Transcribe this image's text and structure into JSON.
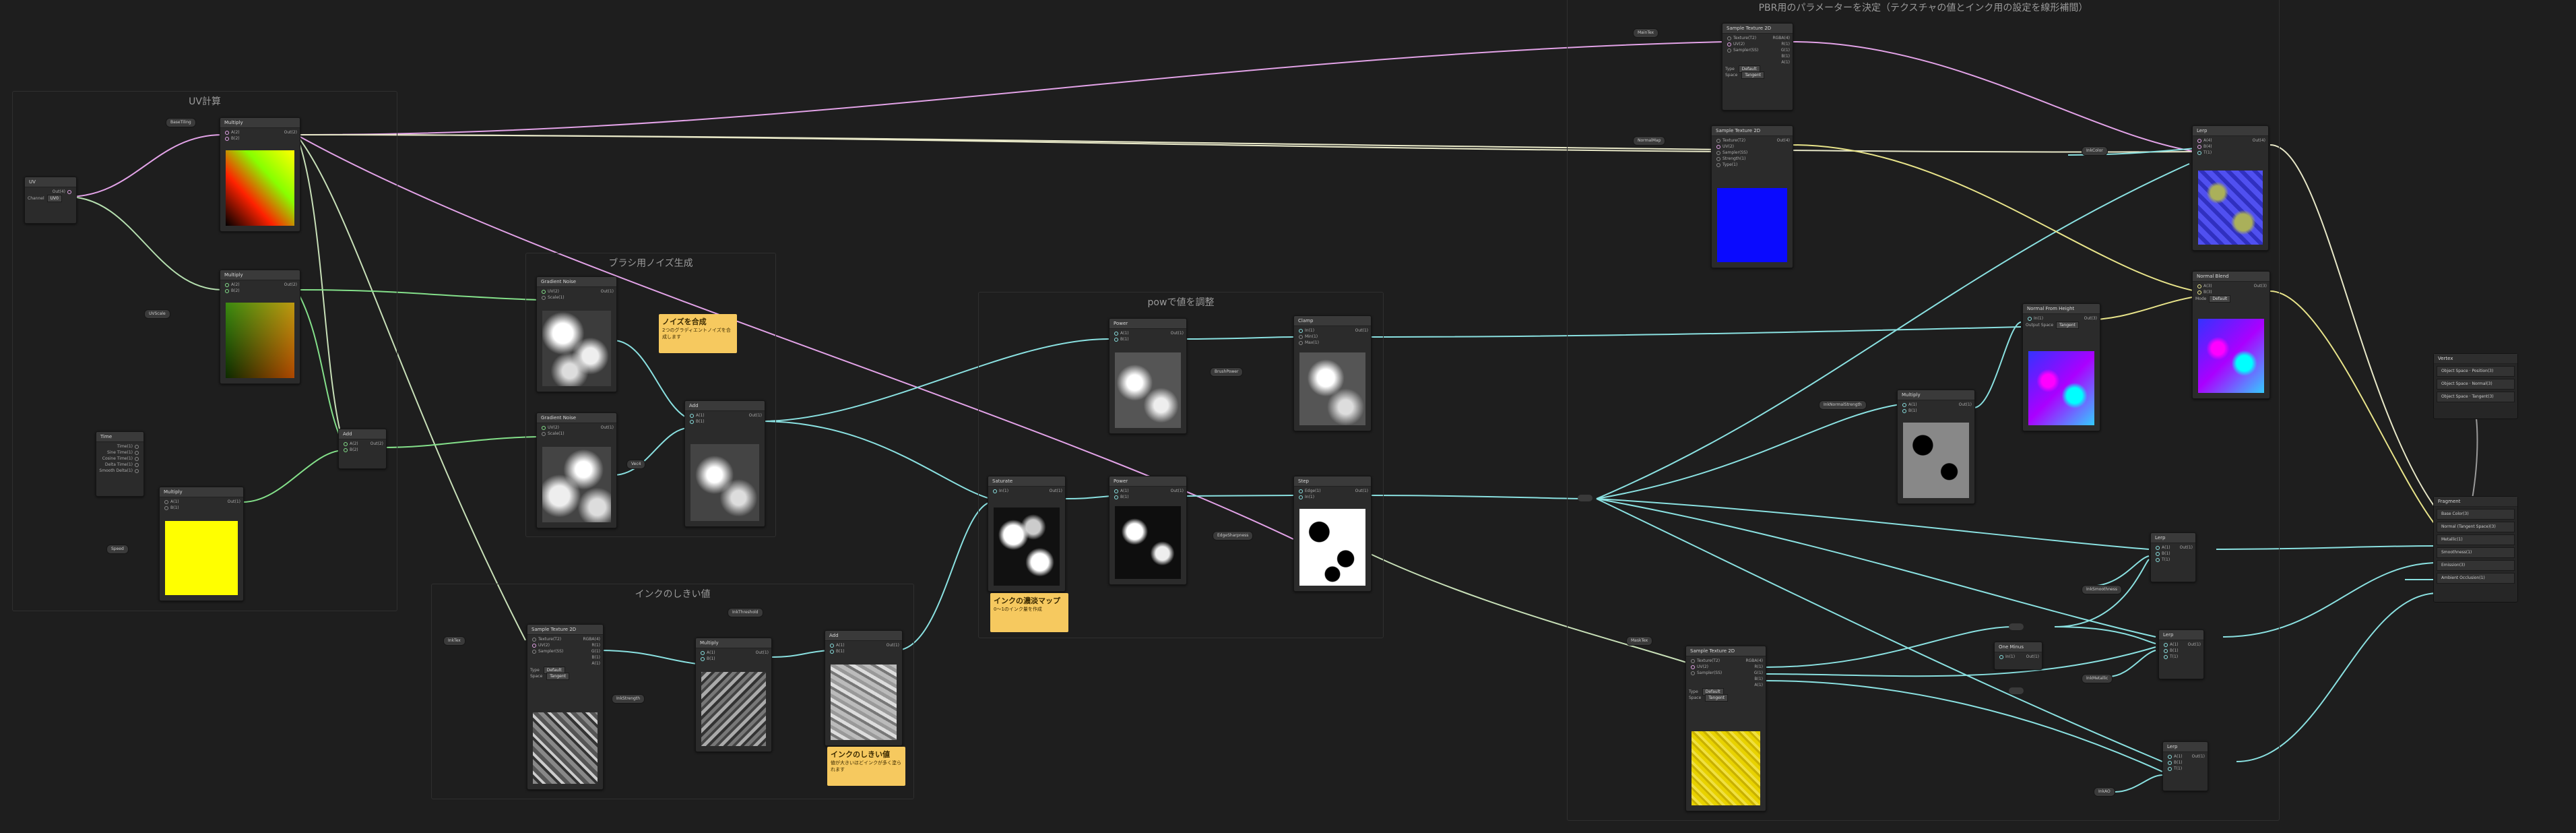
{
  "groups": {
    "uv": "UV計算",
    "noise": "ブラシ用ノイズ生成",
    "pow": "powで値を調整",
    "ink": "インクのしきい値",
    "pbr": "PBR用のパラメーターを決定（テクスチャの値とインク用の設定を線形補間）"
  },
  "nodes": {
    "uv": {
      "title": "UV",
      "out": "Out(4)",
      "channel_label": "Channel",
      "channel_value": "UV0"
    },
    "tiling_param": "BaseTiling",
    "multiply1": {
      "title": "Multiply",
      "a": "A(2)",
      "b": "B(2)",
      "out": "Out(2)"
    },
    "multiply2": {
      "title": "Multiply",
      "a": "A(2)",
      "b": "B(2)",
      "out": "Out(2)"
    },
    "uvscale_param": "UVScale",
    "time": {
      "title": "Time",
      "ports": [
        "Time(1)",
        "Sine Time(1)",
        "Cosine Time(1)",
        "Delta Time(1)",
        "Smooth Delta(1)"
      ]
    },
    "speed_param": "Speed",
    "multiply3": {
      "title": "Multiply",
      "a": "A(1)",
      "b": "B(1)",
      "out": "Out(1)"
    },
    "add_uv": {
      "title": "Add",
      "a": "A(2)",
      "b": "B(2)",
      "out": "Out(2)"
    },
    "noise1": {
      "title": "Gradient Noise",
      "uv": "UV(2)",
      "scale": "Scale(1)",
      "out": "Out(1)"
    },
    "noise2": {
      "title": "Gradient Noise",
      "uv": "UV(2)",
      "scale": "Scale(1)",
      "out": "Out(1)"
    },
    "add_noise": {
      "title": "Add",
      "a": "A(1)",
      "b": "B(1)",
      "out": "Out(1)"
    },
    "noise_scale_param": "Vec4",
    "sticky_noise": {
      "title": "ノイズを合成",
      "body": "2つのグラディエントノイズを合成します"
    },
    "sample_ink": {
      "title": "Sample Texture 2D",
      "ports": [
        "Texture(T2)",
        "UV(2)",
        "Sampler(SS)"
      ],
      "outs": [
        "RGBA(4)",
        "R(1)",
        "G(1)",
        "B(1)",
        "A(1)"
      ],
      "type": "Default",
      "space": "Tangent"
    },
    "ink_tex_param": "InkTex",
    "multiply_ink": {
      "title": "Multiply",
      "a": "A(1)",
      "b": "B(1)",
      "out": "Out(1)"
    },
    "ink_strength_param": "InkStrength",
    "add_ink": {
      "title": "Add",
      "a": "A(1)",
      "b": "B(1)",
      "out": "Out(1)"
    },
    "ink_threshold_param": "InkThreshold",
    "sticky_ink": {
      "title": "インクのしきい値",
      "body": "値が大きいほどインクが多く塗られます"
    },
    "pow1": {
      "title": "Power",
      "a": "A(1)",
      "b": "B(1)",
      "out": "Out(1)"
    },
    "clamp1": {
      "title": "Clamp",
      "in": "In(1)",
      "min": "Min(1)",
      "max": "Max(1)",
      "out": "Out(1)"
    },
    "saturate": {
      "title": "Saturate",
      "in": "In(1)",
      "out": "Out(1)"
    },
    "pow2": {
      "title": "Power",
      "a": "A(1)",
      "b": "B(1)",
      "out": "Out(1)"
    },
    "step": {
      "title": "Step",
      "edge": "Edge(1)",
      "in": "In(1)",
      "out": "Out(1)"
    },
    "brush_power_param": "BrushPower",
    "edge_param": "EdgeSharpness",
    "sticky_pow": {
      "title": "インクの濃淡マップ",
      "body": "0〜1のインク量を作成"
    },
    "sample_top": {
      "title": "Sample Texture 2D",
      "ports": [
        "Texture(T2)",
        "UV(2)",
        "Sampler(SS)"
      ],
      "outs": [
        "RGBA(4)",
        "R(1)",
        "G(1)",
        "B(1)",
        "A(1)"
      ],
      "type": "Default",
      "space": "Tangent"
    },
    "maintex_param": "MainTex",
    "normal_tex_node": {
      "title": "Sample Texture 2D",
      "ports": [
        "Texture(T2)",
        "UV(2)",
        "Sampler(SS)",
        "Strength(1)",
        "Type(1)"
      ],
      "out": "Out(4)"
    },
    "normal_param": "NormalMap",
    "multiply_mask": {
      "title": "Multiply",
      "a": "A(1)",
      "b": "B(1)",
      "out": "Out(1)"
    },
    "ink_normal_param": "InkNormalStrength",
    "normal_strength": {
      "title": "Normal From Height",
      "in": "In(1)",
      "out": "Out(3)",
      "space": "Tangent",
      "space_label": "Output Space"
    },
    "lerp_color": {
      "title": "Lerp",
      "a": "A(4)",
      "b": "B(4)",
      "t": "T(1)",
      "out": "Out(4)"
    },
    "ink_color_param": "InkColor",
    "normal_blend": {
      "title": "Normal Blend",
      "a": "A(3)",
      "b": "B(3)",
      "out": "Out(3)",
      "mode": "Default",
      "mode_label": "Mode"
    },
    "sample_bottom": {
      "title": "Sample Texture 2D",
      "ports": [
        "Texture(T2)",
        "UV(2)",
        "Sampler(SS)"
      ],
      "outs": [
        "RGBA(4)",
        "R(1)",
        "G(1)",
        "B(1)",
        "A(1)"
      ],
      "type": "Default",
      "space": "Tangent"
    },
    "mask_tex_param": "MaskTex",
    "one_minus": {
      "title": "One Minus",
      "in": "In(1)",
      "out": "Out(1)"
    },
    "lerp_smooth": {
      "title": "Lerp",
      "a": "A(1)",
      "b": "B(1)",
      "t": "T(1)",
      "out": "Out(1)"
    },
    "ink_smooth_param": "InkSmoothness",
    "lerp_metal": {
      "title": "Lerp",
      "a": "A(1)",
      "b": "B(1)",
      "t": "T(1)",
      "out": "Out(1)"
    },
    "ink_metal_param": "InkMetallic",
    "lerp_ao": {
      "title": "Lerp",
      "a": "A(1)",
      "b": "B(1)",
      "t": "T(1)",
      "out": "Out(1)"
    },
    "ao_param": "InkAO"
  },
  "vertex": {
    "title": "Vertex",
    "ports": [
      "Position(3)",
      "Normal(3)",
      "Tangent(3)"
    ],
    "spaces": [
      "Object Space",
      "Object Space",
      "Object Space"
    ]
  },
  "fragment": {
    "title": "Fragment",
    "ports": [
      "Base Color(3)",
      "Normal (Tangent Space)(3)",
      "Metallic(1)",
      "Smoothness(1)",
      "Emission(3)",
      "Ambient Occlusion(1)"
    ]
  },
  "colors": {
    "wire_uv": "#e3a3e8",
    "wire_float": "#8ae1e1",
    "wire_vec2": "#84e08a",
    "wire_vec3": "#e8e48a",
    "sticky": "#f6c95f",
    "background": "#1e1e1e"
  }
}
